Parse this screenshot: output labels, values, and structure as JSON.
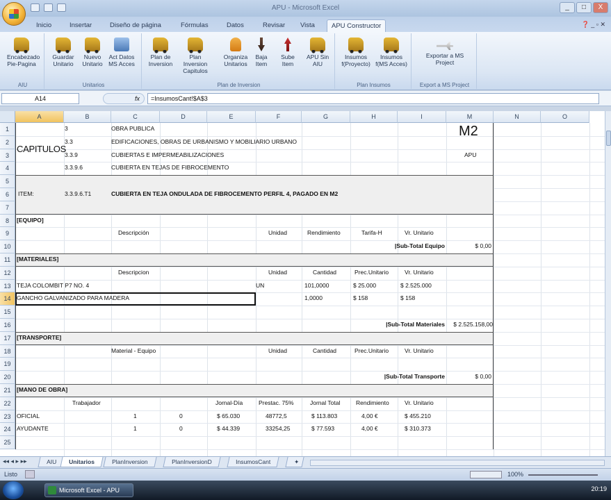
{
  "window": {
    "title": "APU - Microsoft Excel",
    "controls": [
      "_",
      "□",
      "X"
    ]
  },
  "ribbon_tabs": [
    "Inicio",
    "Insertar",
    "Diseño de página",
    "Fórmulas",
    "Datos",
    "Revisar",
    "Vista",
    "APU Constructor"
  ],
  "active_tab": "APU Constructor",
  "ribbon_groups": [
    {
      "label": "AIU",
      "buttons": [
        {
          "label": "Encabezado Pie-Pagina",
          "icon": "truck-icon"
        }
      ]
    },
    {
      "label": "Unitarios",
      "buttons": [
        {
          "label": "Guardar Unitario",
          "icon": "truck-icon"
        },
        {
          "label": "Nuevo Unitario",
          "icon": "truck-icon"
        },
        {
          "label": "Act Datos MS Acces",
          "icon": "truck-icon"
        }
      ]
    },
    {
      "label": "Plan de Inversion",
      "buttons": [
        {
          "label": "Plan de Inversion",
          "icon": "truck-icon"
        },
        {
          "label": "Plan Inversion Capitulos",
          "icon": "truck-icon"
        },
        {
          "label": "Organiza Unitarios",
          "icon": "worker-icon"
        },
        {
          "label": "Baja Item",
          "icon": "arrow-down-icon"
        },
        {
          "label": "Sube Item",
          "icon": "arrow-up-icon"
        },
        {
          "label": "APU Sin AIU",
          "icon": "truck-icon"
        }
      ]
    },
    {
      "label": "Plan Insumos",
      "buttons": [
        {
          "label": "Insumos f(Proyecto)",
          "icon": "truck-icon"
        },
        {
          "label": "Insumos f(MS Acces)",
          "icon": "truck-icon"
        }
      ]
    },
    {
      "label": "Export a MS Project",
      "buttons": [
        {
          "label": "Exportar a MS Project",
          "icon": "plane-icon"
        }
      ]
    }
  ],
  "formula_bar": {
    "name_box": "A14",
    "fx": "fx",
    "formula": "=InsumosCant!$A$3"
  },
  "columns": [
    "A",
    "B",
    "C",
    "D",
    "E",
    "F",
    "G",
    "H",
    "I",
    "M",
    "N",
    "O"
  ],
  "rows": [
    "1",
    "2",
    "3",
    "4",
    "5",
    "6",
    "7",
    "8",
    "9",
    "10",
    "11",
    "12",
    "13",
    "14",
    "15",
    "16",
    "17",
    "18",
    "19",
    "20",
    "21",
    "22",
    "23",
    "24",
    "25"
  ],
  "sheet": {
    "capitulos": "CAPITULOS",
    "codes": [
      "3",
      "3.3",
      "3.3.9",
      "3.3.9.6"
    ],
    "descriptions": [
      "OBRA PUBLICA",
      "EDIFICACIONES, OBRAS DE URBANISMO Y MOBILIARIO URBANO",
      "CUBIERTAS E IMPERMEABILIZACIONES",
      "CUBIERTA EN TEJAS DE FIBROCEMENTO"
    ],
    "unit": "M2",
    "unit_sub": "APU",
    "item_label": "ITEM:",
    "item_code": "3.3.9.6.T1",
    "item_desc": "CUBIERTA EN TEJA ONDULADA DE FIBROCEMENTO PERFIL 4, PAGADO EN M2",
    "equipo": {
      "title": "[EQUIPO]",
      "headers": [
        "Descripción",
        "Unidad",
        "Rendimiento",
        "Tarifa-H",
        "Vr. Unitario"
      ],
      "subtotal_label": "|Sub-Total Equipo",
      "subtotal": "$ 0,00"
    },
    "materiales": {
      "title": "[MATERIALES]",
      "headers": [
        "Descripcion",
        "Unidad",
        "Cantidad",
        "Prec.Unitario",
        "Vr. Unitario"
      ],
      "rows": [
        [
          "TEJA COLOMBIT P7 NO. 4",
          "UN",
          "101,0000",
          "$ 25.000",
          "$ 2.525.000"
        ],
        [
          "GANCHO GALVANIZADO PARA MADERA",
          "",
          "1,0000",
          "$ 158",
          "$ 158"
        ]
      ],
      "subtotal_label": "|Sub-Total Materiales",
      "subtotal": "$ 2.525.158,00"
    },
    "transporte": {
      "title": "[TRANSPORTE]",
      "headers": [
        "Material - Equipo",
        "Unidad",
        "Cantidad",
        "Prec.Unitario",
        "Vr. Unitario"
      ],
      "subtotal_label": "|Sub-Total Transporte",
      "subtotal": "$ 0,00"
    },
    "mano_obra": {
      "title": "[MANO DE OBRA]",
      "headers": [
        "Trabajador",
        "Jornal-Día",
        "Prestac. 75%",
        "Jornal Total",
        "Rendimiento",
        "Vr. Unitario"
      ],
      "rows": [
        [
          "OFICIAL",
          "1",
          "0",
          "$ 65.030",
          "48772,5",
          "$ 113.803",
          "4,00 €",
          "$ 455.210"
        ],
        [
          "AYUDANTE",
          "1",
          "0",
          "$ 44.339",
          "33254,25",
          "$ 77.593",
          "4,00 €",
          "$ 310.373"
        ]
      ]
    }
  },
  "sheet_tabs": [
    "AIU",
    "Unitarios",
    "PlanInversion",
    "PlanInversionD",
    "InsumosCant"
  ],
  "active_sheet": "Unitarios",
  "status": {
    "mode": "Listo",
    "zoom": "100%"
  },
  "taskbar": {
    "app": "Microsoft Excel - APU",
    "clock": "20:19"
  }
}
